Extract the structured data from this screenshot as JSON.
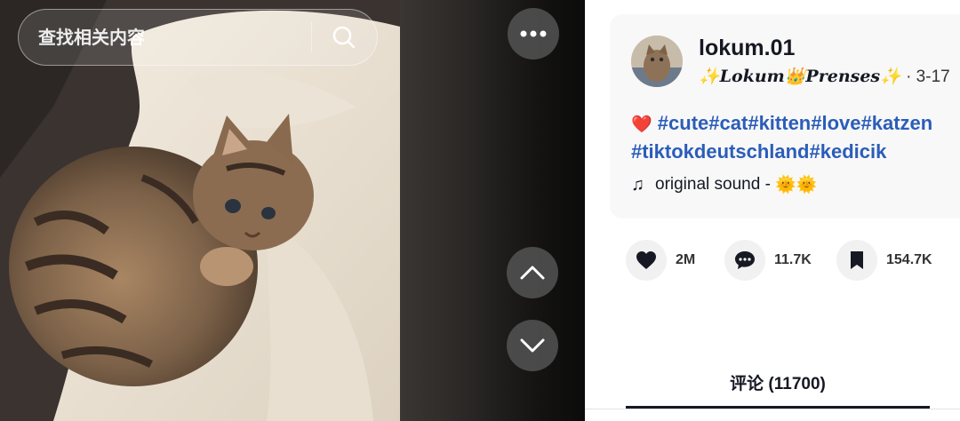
{
  "search": {
    "placeholder": "查找相关内容"
  },
  "video": {
    "description": "tabby kitten curled up on a white blanket"
  },
  "author": {
    "username": "lokum.01",
    "nickname": "✨𝑳𝒐𝒌𝒖𝒎👑𝑷𝒓𝒆𝒏𝒔𝒆𝒔✨",
    "date": "· 3-17"
  },
  "caption": {
    "emoji": "❤️",
    "hashtags": [
      "#cute",
      "#cat",
      "#kitten",
      "#love",
      "#katzen",
      "#tiktokdeutschland",
      "#kedicik"
    ]
  },
  "music": {
    "title": "original sound -",
    "suffix": "🌞🌞"
  },
  "actions": {
    "likes": "2M",
    "comments": "11.7K",
    "saves": "154.7K"
  },
  "tabs": {
    "comments": "评论 (11700)"
  }
}
